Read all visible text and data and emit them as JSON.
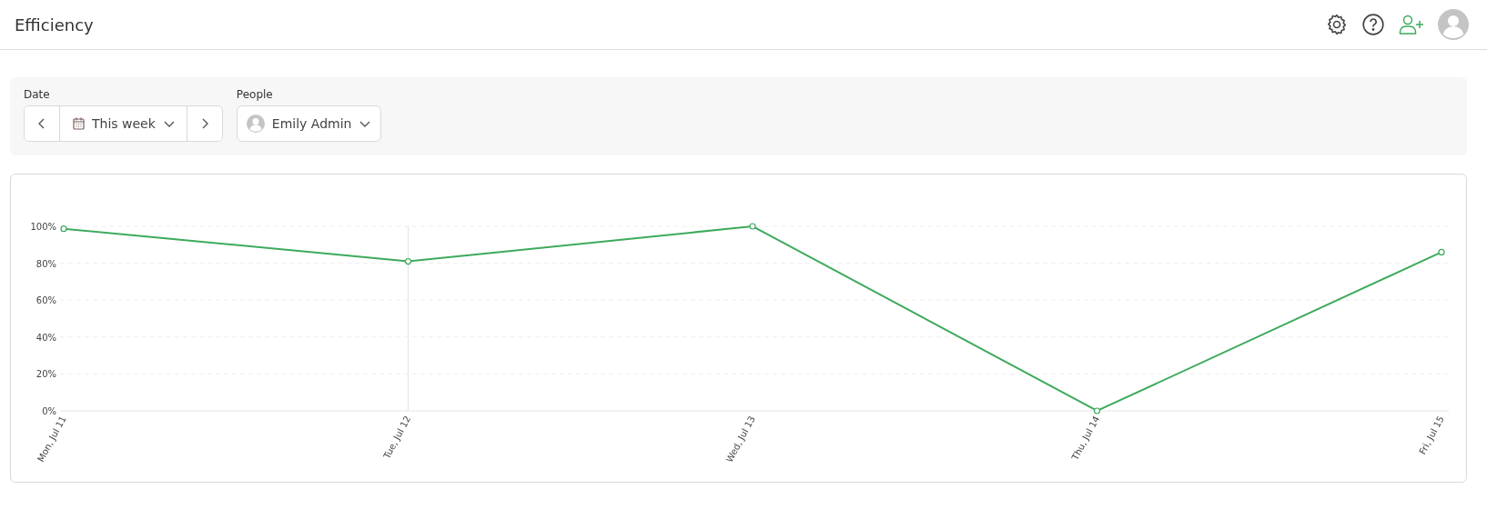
{
  "header": {
    "title": "Efficiency"
  },
  "filters": {
    "date": {
      "label": "Date",
      "value": "This week"
    },
    "people": {
      "label": "People",
      "value": "Emily Admin"
    }
  },
  "chart": {
    "chart_data": {
      "type": "line",
      "categories": [
        "Mon, Jul 11",
        "Tue, Jul 12",
        "Wed, Jul 13",
        "Thu, Jul 14",
        "Fri, Jul 15"
      ],
      "series": [
        {
          "color": "#3daa5c",
          "marker": true,
          "values": [
            98.7,
            81,
            100,
            0,
            86
          ]
        }
      ],
      "grid": true,
      "ref_lines": [
        {
          "axis": "x",
          "value": "Tue, Jul 12"
        }
      ],
      "ylim": [
        0,
        100
      ],
      "yticks": [
        {
          "value": 0,
          "label": "0%"
        },
        {
          "value": 20,
          "label": "20%"
        },
        {
          "value": 40,
          "label": "40%"
        },
        {
          "value": 60,
          "label": "60%"
        },
        {
          "value": 80,
          "label": "80%"
        },
        {
          "value": 100,
          "label": "100%"
        }
      ]
    }
  }
}
